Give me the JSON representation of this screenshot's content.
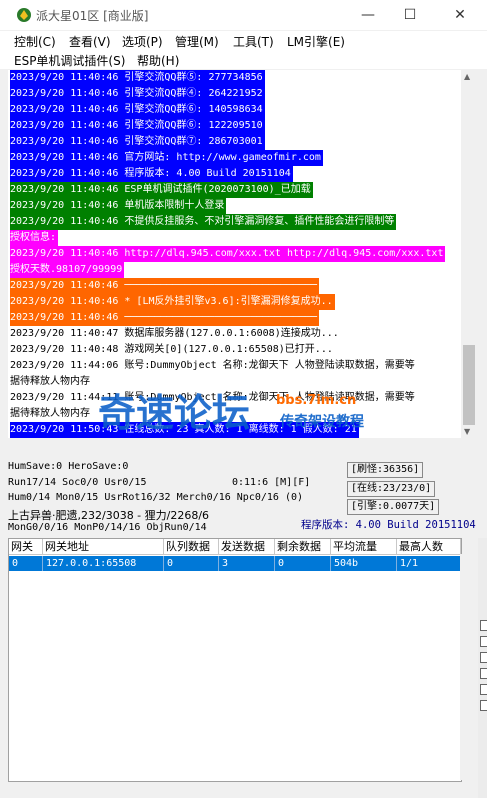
{
  "window": {
    "title": "派大星01区 [商业版]",
    "minimize": "—",
    "maximize": "☐",
    "close": "✕"
  },
  "menus": {
    "row1": [
      "控制(C)",
      "查看(V)",
      "选项(P)",
      "管理(M)",
      "工具(T)",
      "LM引擎(E)"
    ],
    "row2": [
      "ESP单机调试插件(S)",
      "帮助(H)"
    ]
  },
  "log": [
    {
      "text": "2023/9/20 11:40:46 引擎交流QQ群⑤: 277734856",
      "bg": "#0000ff",
      "fg": "#ffffff"
    },
    {
      "text": "2023/9/20 11:40:46 引擎交流QQ群④: 264221952",
      "bg": "#0000ff",
      "fg": "#ffffff"
    },
    {
      "text": "2023/9/20 11:40:46 引擎交流QQ群⑥: 140598634",
      "bg": "#0000ff",
      "fg": "#ffffff"
    },
    {
      "text": "2023/9/20 11:40:46 引擎交流QQ群⑥: 122209510",
      "bg": "#0000ff",
      "fg": "#ffffff"
    },
    {
      "text": "2023/9/20 11:40:46 引擎交流QQ群⑦: 286703001",
      "bg": "#0000ff",
      "fg": "#ffffff"
    },
    {
      "text": "2023/9/20 11:40:46 官方网站: http://www.gameofmir.com",
      "bg": "#0000ff",
      "fg": "#ffffff"
    },
    {
      "text": "2023/9/20 11:40:46 程序版本: 4.00 Build 20151104",
      "bg": "#0000ff",
      "fg": "#ffffff"
    },
    {
      "text": "2023/9/20 11:40:46 ESP单机调试插件(2020073100)_已加载",
      "bg": "#008000",
      "fg": "#ffffff"
    },
    {
      "text": "2023/9/20 11:40:46 单机版本限制十人登录",
      "bg": "#008000",
      "fg": "#ffffff"
    },
    {
      "text": "2023/9/20 11:40:46 不提供反挂服务、不对引擎漏洞修复、插件性能会进行限制等",
      "bg": "#008000",
      "fg": "#ffffff"
    },
    {
      "text": "授权信息:",
      "bg": "#ff00ff",
      "fg": "#ffffff"
    },
    {
      "text": "2023/9/20 11:40:46 http://dlq.945.com/xxx.txt http://dlq.945.com/xxx.txt",
      "bg": "#ff00ff",
      "fg": "#ffffff"
    },
    {
      "text": "授权天数.98107/99999",
      "bg": "#ff00ff",
      "fg": "#ffffff"
    },
    {
      "text": "2023/9/20 11:40:46 ────────────────────────────────",
      "bg": "#ff6600",
      "fg": "#ffffff"
    },
    {
      "text": "2023/9/20 11:40:46 * [LM反外挂引擎v3.6]:引擎漏洞修复成功..",
      "bg": "#ff6600",
      "fg": "#ffffff"
    },
    {
      "text": "2023/9/20 11:40:46 ────────────────────────────────",
      "bg": "#ff6600",
      "fg": "#ffffff"
    },
    {
      "text": "2023/9/20 11:40:47 数据库服务器(127.0.0.1:6008)连接成功...",
      "bg": "",
      "fg": "#000000"
    },
    {
      "text": "2023/9/20 11:40:48 游戏网关[0](127.0.0.1:65508)已打开...",
      "bg": "",
      "fg": "#000000"
    },
    {
      "text": "2023/9/20 11:44:06 账号:DummyObject 名称:龙御天下 人物登陆读取数据，需要等",
      "bg": "",
      "fg": "#000000"
    },
    {
      "text": "据待释放人物内存",
      "bg": "",
      "fg": "#000000"
    },
    {
      "text": "2023/9/20 11:44:11 账号:DummyObject 名称:龙御天下 人物登陆读取数据，需要等",
      "bg": "",
      "fg": "#000000"
    },
    {
      "text": "据待释放人物内存",
      "bg": "",
      "fg": "#000000"
    },
    {
      "text": "2023/9/20 11:50:43 在线总数: 23 真人数: 1 离线数: 1 假人数: 21",
      "bg": "#0000ff",
      "fg": "#ffffff"
    }
  ],
  "watermark": {
    "main": "奇速论坛",
    "sub": "传奇架设教程",
    "url": "bbs.7im.cn"
  },
  "status": {
    "line1": "HumSave:0 HeroSave:0",
    "line2": "Run17/14 Soc0/0 Usr0/15",
    "timer": "0:11:6 [M][F]",
    "line3": "Hum0/14 Mon0/15 UsrRot16/32 Merch0/16 Npc0/16 (0)",
    "line4": "上古异兽·肥遗,232/3038 - 狸力/2268/6",
    "line5": "MonG0/0/16 MonP0/14/16 ObjRun0/14",
    "refresh": "[刷怪:36356]",
    "online": "[在线:23/23/0]",
    "engine": "[引擎:0.0077天]",
    "version": "程序版本: 4.00 Build 20151104"
  },
  "table": {
    "headers": [
      "网关",
      "网关地址",
      "队列数据",
      "发送数据",
      "剩余数据",
      "平均流量",
      "最高人数"
    ],
    "rows": [
      [
        "0",
        "127.0.0.1:65508",
        "0",
        "3",
        "0",
        "504b",
        "1/1"
      ]
    ]
  }
}
